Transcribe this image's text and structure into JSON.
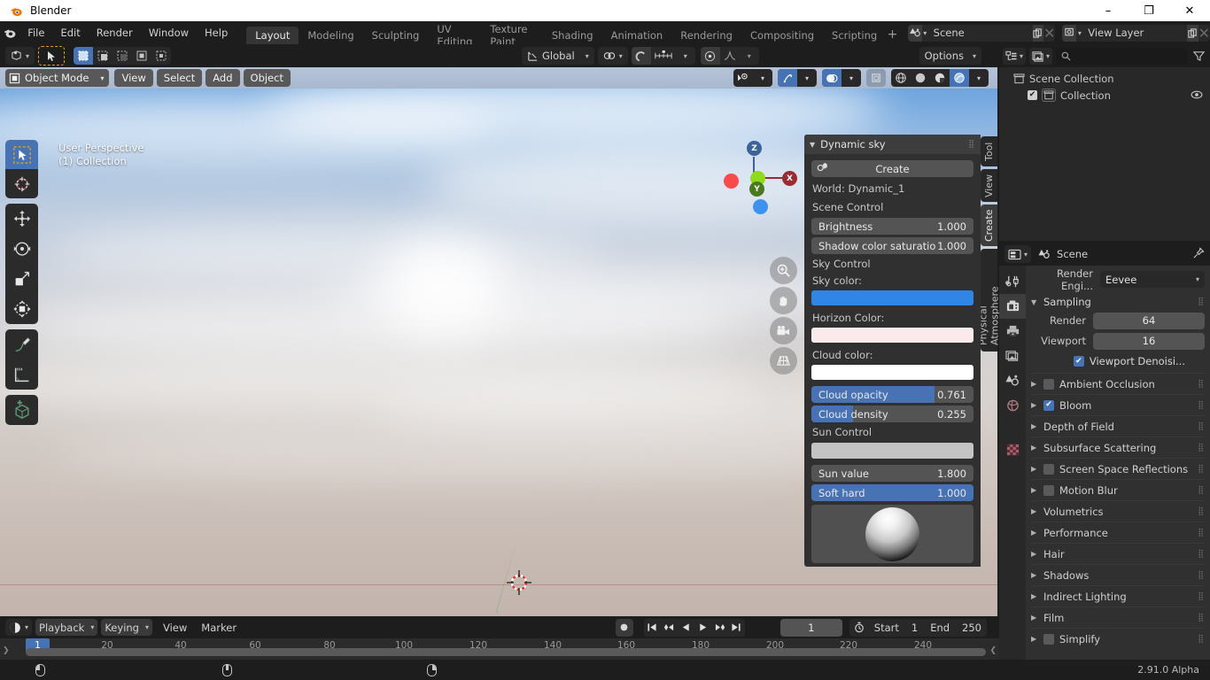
{
  "window": {
    "title": "Blender",
    "app_icon": "blender-logo-icon",
    "minimize": "–",
    "maximize": "❐",
    "close": "✕"
  },
  "topbar": {
    "menus": [
      "File",
      "Edit",
      "Render",
      "Window",
      "Help"
    ],
    "workspaces": [
      "Layout",
      "Modeling",
      "Sculpting",
      "UV Editing",
      "Texture Paint",
      "Shading",
      "Animation",
      "Rendering",
      "Compositing",
      "Scripting"
    ],
    "active_workspace": "Layout",
    "add_workspace": "+",
    "scene": {
      "label": "Scene",
      "icon": "scene-icon",
      "new_btn": "new-scene-icon",
      "unlink_btn": "unlink-icon"
    },
    "view_layer": {
      "label": "View Layer",
      "icon": "view-layer-icon",
      "new_btn": "new-layer-icon",
      "unlink_btn": "unlink-icon"
    }
  },
  "viewport": {
    "header": {
      "editor_type": "editor-type-icon",
      "select_tool": "cursor-select-icon",
      "select_modes": [
        "select-set",
        "select-extend",
        "select-subtract",
        "select-invert",
        "select-intersect"
      ],
      "transform_orientation": "Global",
      "pivot_icon": "pivot-point-icon",
      "snap_icon": "snap-magnet-icon",
      "snap_target_icon": "snap-increment-icon",
      "proportional_icon": "proportional-edit-icon",
      "falloff_icon": "falloff-curve-icon",
      "options": "Options",
      "visibility_icon": "show-hide-icon",
      "gizmo_icon": "gizmo-icon",
      "overlays_icon": "overlays-icon",
      "xray_icon": "xray-toggle-icon",
      "shading_modes": [
        "wireframe",
        "solid",
        "material-preview",
        "rendered"
      ],
      "active_shading": "rendered"
    },
    "header2": {
      "mode": "Object Mode",
      "menus": [
        "View",
        "Select",
        "Add",
        "Object"
      ]
    },
    "overlay_text": [
      "User Perspective",
      "(1) Collection"
    ],
    "gizmo_axes": [
      {
        "label": "Z",
        "color": "#3d6298"
      },
      {
        "label": "Y",
        "color": "#4a7a1e"
      },
      {
        "label": "X",
        "color": "#9c2b30"
      },
      {
        "label": "",
        "color": "#fa4a4a"
      },
      {
        "label": "",
        "color": "#3d92f0"
      },
      {
        "label": "",
        "color": "#8fdb1b"
      }
    ],
    "nav_buttons": [
      "zoom-icon",
      "pan-hand-icon",
      "camera-view-icon",
      "toggle-perspective-icon"
    ],
    "side_tabs": [
      {
        "label": "Tool",
        "active": false
      },
      {
        "label": "View",
        "active": false
      },
      {
        "label": "Create",
        "active": true
      },
      {
        "label": "Physical Atmosphere",
        "active": false
      }
    ],
    "toolbar_tools": [
      "tweak-select-box-icon",
      "cursor-3d-icon",
      "move-icon",
      "rotate-icon",
      "scale-icon",
      "transform-icon",
      "annotate-icon",
      "measure-icon",
      "add-cube-icon"
    ]
  },
  "dynamic_sky": {
    "title": "Dynamic sky",
    "collapse_icon": "triangle-down-icon",
    "grip_icon": "drag-grip-icon",
    "create_button": {
      "label": "Create",
      "icon": "dynamic-sky-icon"
    },
    "world_label": "World: Dynamic_1",
    "scene_control_label": "Scene Control",
    "brightness": {
      "label": "Brightness",
      "value": "1.000",
      "fill": 0
    },
    "shadow_saturation": {
      "label": "Shadow color saturatio",
      "value": "1.000",
      "fill": 0
    },
    "sky_control_label": "Sky Control",
    "sky_color": {
      "label": "Sky color:",
      "hex": "#2f86e6"
    },
    "horizon_color": {
      "label": "Horizon Color:",
      "hex": "#fbeaea"
    },
    "cloud_color": {
      "label": "Cloud color:",
      "hex": "#ffffff"
    },
    "cloud_opacity": {
      "label": "Cloud opacity",
      "value": "0.761",
      "fill": 76.1
    },
    "cloud_density": {
      "label": "Cloud density",
      "value": "0.255",
      "fill": 25.5
    },
    "sun_control_label": "Sun Control",
    "sun_color": {
      "hex": "#c4c4c4"
    },
    "sun_value": {
      "label": "Sun value",
      "value": "1.800",
      "fill": 0
    },
    "soft_hard": {
      "label": "Soft hard",
      "value": "1.000",
      "fill": 100
    },
    "preview_icon": "sun-sphere-preview"
  },
  "outliner": {
    "display_mode_icon": "outliner-display-icon",
    "filter_id_icon": "filter-id-icon",
    "search_placeholder": "",
    "search_icon": "search-icon",
    "filter_icon": "funnel-filter-icon",
    "rows": [
      {
        "label": "Scene Collection",
        "icon": "collection-icon",
        "indent": 1,
        "checkbox": null,
        "eye": false
      },
      {
        "label": "Collection",
        "icon": "collection-icon",
        "indent": 2,
        "checkbox": true,
        "eye": true
      }
    ]
  },
  "properties": {
    "editor_icon": "properties-editor-icon",
    "context_icon": "scene-props-icon",
    "context_label": "Scene",
    "pin_icon": "pin-icon",
    "tabs": [
      "tool-icon",
      "render-props-icon",
      "output-props-icon",
      "view-layer-props-icon",
      "scene-props-icon",
      "world-props-icon",
      "texture-props-icon"
    ],
    "active_tab_index": 1,
    "render_engine": {
      "label": "Render Engi...",
      "value": "Eevee",
      "chevron": "chevron-down-icon"
    },
    "sampling": {
      "title": "Sampling",
      "render": {
        "label": "Render",
        "value": "64"
      },
      "viewport": {
        "label": "Viewport",
        "value": "16"
      },
      "denoising": {
        "label": "Viewport Denoisi...",
        "checked": true
      }
    },
    "panels": [
      {
        "label": "Ambient Occlusion",
        "checkbox": false
      },
      {
        "label": "Bloom",
        "checkbox": true
      },
      {
        "label": "Depth of Field",
        "checkbox": null
      },
      {
        "label": "Subsurface Scattering",
        "checkbox": null
      },
      {
        "label": "Screen Space Reflections",
        "checkbox": false
      },
      {
        "label": "Motion Blur",
        "checkbox": false
      },
      {
        "label": "Volumetrics",
        "checkbox": null
      },
      {
        "label": "Performance",
        "checkbox": null
      },
      {
        "label": "Hair",
        "checkbox": null
      },
      {
        "label": "Shadows",
        "checkbox": null
      },
      {
        "label": "Indirect Lighting",
        "checkbox": null
      },
      {
        "label": "Film",
        "checkbox": null
      },
      {
        "label": "Simplify",
        "checkbox": false
      }
    ]
  },
  "timeline": {
    "editor_icon": "timeline-editor-icon",
    "menus": [
      "Playback",
      "Keying",
      "View",
      "Marker"
    ],
    "record_icon": "auto-keying-icon",
    "playback_buttons": [
      "jump-start-icon",
      "prev-keyframe-icon",
      "play-reverse-icon",
      "play-icon",
      "next-keyframe-icon",
      "jump-end-icon"
    ],
    "current_frame": "1",
    "timer_icon": "use-preview-range-icon",
    "start_label": "Start",
    "start_value": "1",
    "end_label": "End",
    "end_value": "250",
    "ruler_ticks": [
      "20",
      "40",
      "60",
      "80",
      "100",
      "120",
      "140",
      "160",
      "180",
      "200",
      "220",
      "240"
    ],
    "playhead_label": "1"
  },
  "statusbar": {
    "hints": [
      {
        "icon": "mouse-left-icon",
        "label": ""
      },
      {
        "icon": "mouse-middle-icon",
        "label": ""
      },
      {
        "icon": "mouse-right-icon",
        "label": ""
      }
    ],
    "version": "2.91.0 Alpha"
  },
  "colors": {
    "accent_blue": "#4772b3",
    "header_dark": "#1d1d1d",
    "panel_bg": "#303030",
    "widget_bg": "#545454",
    "editor_bg": "#282828"
  }
}
